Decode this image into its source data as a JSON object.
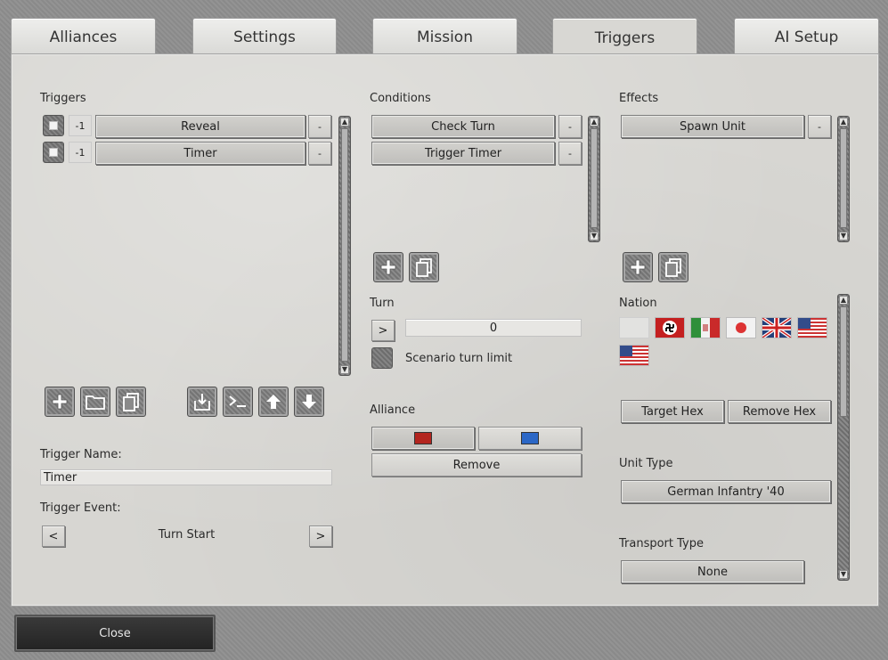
{
  "tabs": [
    {
      "label": "Alliances"
    },
    {
      "label": "Settings"
    },
    {
      "label": "Mission"
    },
    {
      "label": "Triggers"
    },
    {
      "label": "AI Setup"
    }
  ],
  "triggers": {
    "heading": "Triggers",
    "rows": [
      {
        "index": "-1",
        "name": "Reveal",
        "remove": "-"
      },
      {
        "index": "-1",
        "name": "Timer",
        "remove": "-"
      }
    ],
    "trigger_name_label": "Trigger Name:",
    "trigger_name_value": "Timer",
    "trigger_event_label": "Trigger Event:",
    "trigger_event_value": "Turn Start",
    "prev": "<",
    "next": ">"
  },
  "conditions": {
    "heading": "Conditions",
    "rows": [
      {
        "name": "Check Turn",
        "remove": "-"
      },
      {
        "name": "Trigger Timer",
        "remove": "-"
      }
    ],
    "turn_label": "Turn",
    "turn_arrow": ">",
    "turn_value": "0",
    "scenario_limit_label": "Scenario turn limit",
    "alliance_label": "Alliance",
    "alliance_colors": [
      "#b3251f",
      "#2b67c6"
    ],
    "remove_label": "Remove"
  },
  "effects": {
    "heading": "Effects",
    "rows": [
      {
        "name": "Spawn Unit",
        "remove": "-"
      }
    ],
    "nation_label": "Nation",
    "target_hex_label": "Target Hex",
    "remove_hex_label": "Remove Hex",
    "unit_type_label": "Unit Type",
    "unit_type_value": "German Infantry '40",
    "transport_type_label": "Transport Type",
    "transport_type_value": "None"
  },
  "close_label": "Close"
}
